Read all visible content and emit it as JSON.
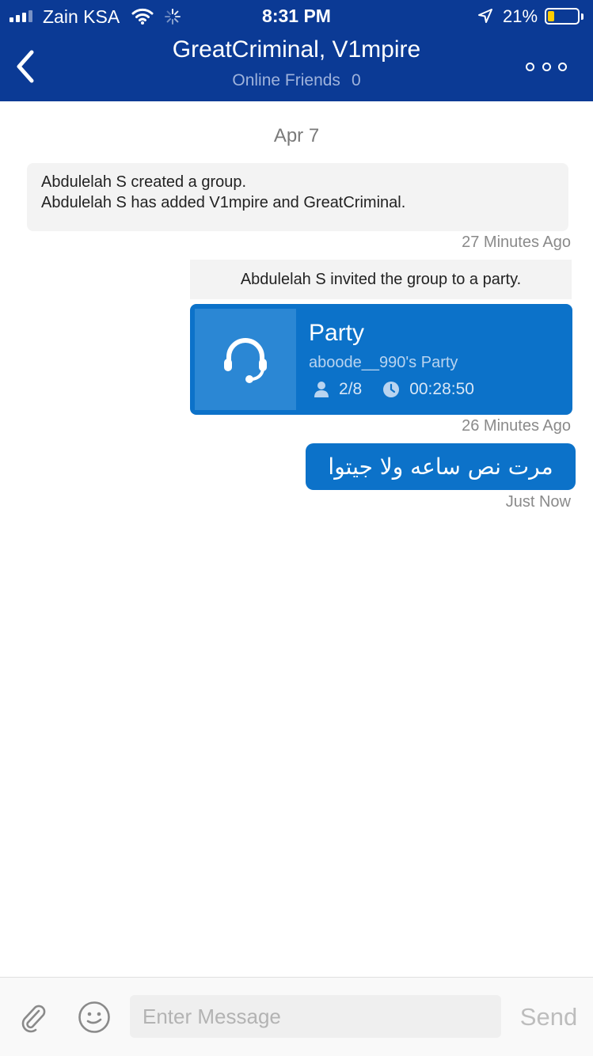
{
  "status_bar": {
    "carrier": "Zain KSA",
    "time": "8:31 PM",
    "battery_percent": "21%",
    "battery_level": 0.21,
    "battery_color": "#ffcc00",
    "icons": [
      "signal-icon",
      "wifi-icon",
      "activity-icon",
      "location-icon",
      "battery-icon"
    ]
  },
  "nav": {
    "title": "GreatCriminal, V1mpire",
    "subtitle_label": "Online Friends",
    "online_count": "0",
    "back_icon": "chevron-left-icon",
    "more_icon": "more-icon",
    "background_color": "#0b3a95"
  },
  "conversation": {
    "date": "Apr 7",
    "system_message": {
      "line1": "Abdulelah S created a group.",
      "line2": "Abdulelah S has added V1mpire and GreatCriminal.",
      "timestamp": "27 Minutes Ago"
    },
    "invite": {
      "note": "Abdulelah S invited the group to a party.",
      "card": {
        "title": "Party",
        "host": "aboode__990's Party",
        "members": "2/8",
        "duration": "00:28:50",
        "icon": "headset-icon",
        "accent_color": "#0c72c9"
      },
      "timestamp": "26 Minutes Ago"
    },
    "outgoing_message": {
      "text": "مرت نص ساعه ولا جيتوا",
      "timestamp": "Just Now"
    }
  },
  "composer": {
    "placeholder": "Enter Message",
    "value": "",
    "send_label": "Send",
    "attach_icon": "paperclip-icon",
    "emoji_icon": "emoji-icon"
  }
}
